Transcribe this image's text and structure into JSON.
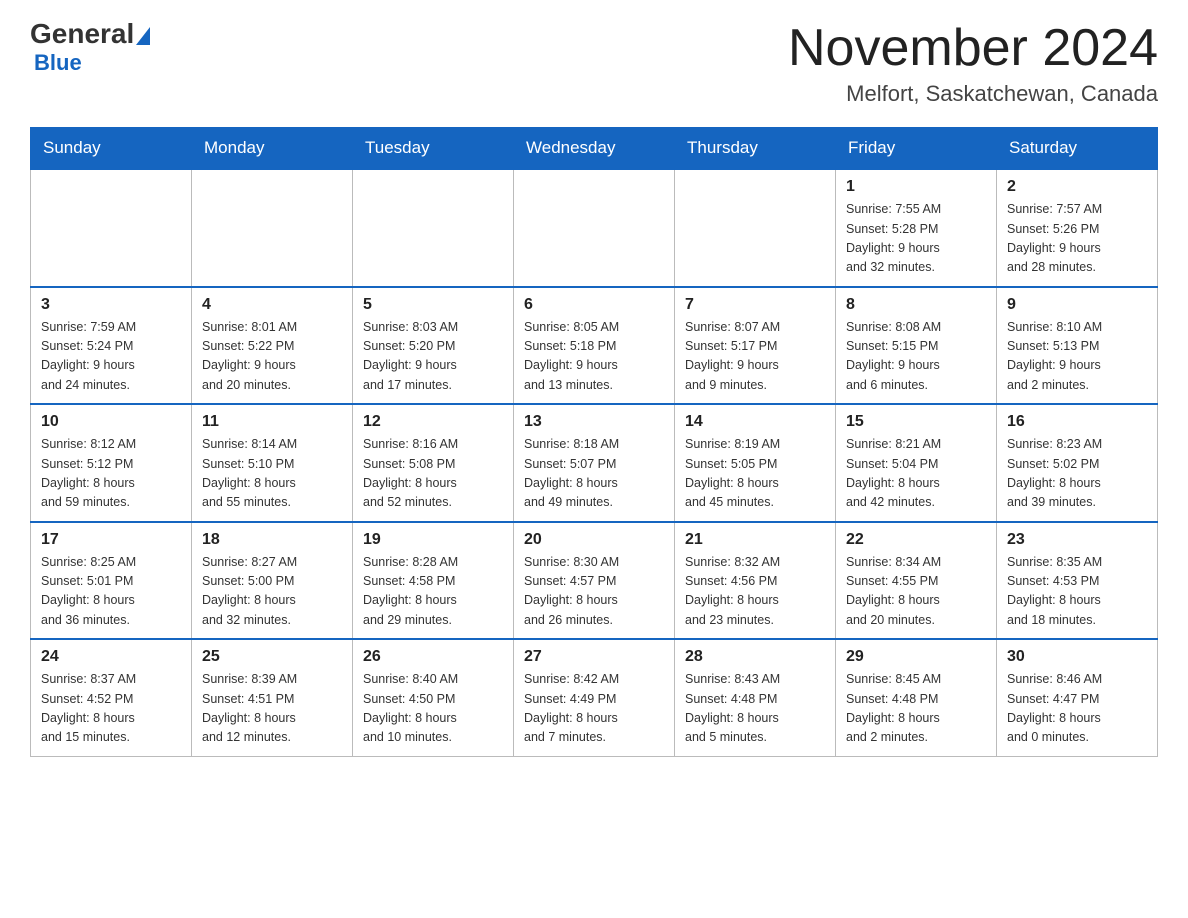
{
  "header": {
    "logo_general": "General",
    "logo_blue": "Blue",
    "month_title": "November 2024",
    "location": "Melfort, Saskatchewan, Canada"
  },
  "days_of_week": [
    "Sunday",
    "Monday",
    "Tuesday",
    "Wednesday",
    "Thursday",
    "Friday",
    "Saturday"
  ],
  "weeks": [
    [
      {
        "day": "",
        "info": ""
      },
      {
        "day": "",
        "info": ""
      },
      {
        "day": "",
        "info": ""
      },
      {
        "day": "",
        "info": ""
      },
      {
        "day": "",
        "info": ""
      },
      {
        "day": "1",
        "info": "Sunrise: 7:55 AM\nSunset: 5:28 PM\nDaylight: 9 hours\nand 32 minutes."
      },
      {
        "day": "2",
        "info": "Sunrise: 7:57 AM\nSunset: 5:26 PM\nDaylight: 9 hours\nand 28 minutes."
      }
    ],
    [
      {
        "day": "3",
        "info": "Sunrise: 7:59 AM\nSunset: 5:24 PM\nDaylight: 9 hours\nand 24 minutes."
      },
      {
        "day": "4",
        "info": "Sunrise: 8:01 AM\nSunset: 5:22 PM\nDaylight: 9 hours\nand 20 minutes."
      },
      {
        "day": "5",
        "info": "Sunrise: 8:03 AM\nSunset: 5:20 PM\nDaylight: 9 hours\nand 17 minutes."
      },
      {
        "day": "6",
        "info": "Sunrise: 8:05 AM\nSunset: 5:18 PM\nDaylight: 9 hours\nand 13 minutes."
      },
      {
        "day": "7",
        "info": "Sunrise: 8:07 AM\nSunset: 5:17 PM\nDaylight: 9 hours\nand 9 minutes."
      },
      {
        "day": "8",
        "info": "Sunrise: 8:08 AM\nSunset: 5:15 PM\nDaylight: 9 hours\nand 6 minutes."
      },
      {
        "day": "9",
        "info": "Sunrise: 8:10 AM\nSunset: 5:13 PM\nDaylight: 9 hours\nand 2 minutes."
      }
    ],
    [
      {
        "day": "10",
        "info": "Sunrise: 8:12 AM\nSunset: 5:12 PM\nDaylight: 8 hours\nand 59 minutes."
      },
      {
        "day": "11",
        "info": "Sunrise: 8:14 AM\nSunset: 5:10 PM\nDaylight: 8 hours\nand 55 minutes."
      },
      {
        "day": "12",
        "info": "Sunrise: 8:16 AM\nSunset: 5:08 PM\nDaylight: 8 hours\nand 52 minutes."
      },
      {
        "day": "13",
        "info": "Sunrise: 8:18 AM\nSunset: 5:07 PM\nDaylight: 8 hours\nand 49 minutes."
      },
      {
        "day": "14",
        "info": "Sunrise: 8:19 AM\nSunset: 5:05 PM\nDaylight: 8 hours\nand 45 minutes."
      },
      {
        "day": "15",
        "info": "Sunrise: 8:21 AM\nSunset: 5:04 PM\nDaylight: 8 hours\nand 42 minutes."
      },
      {
        "day": "16",
        "info": "Sunrise: 8:23 AM\nSunset: 5:02 PM\nDaylight: 8 hours\nand 39 minutes."
      }
    ],
    [
      {
        "day": "17",
        "info": "Sunrise: 8:25 AM\nSunset: 5:01 PM\nDaylight: 8 hours\nand 36 minutes."
      },
      {
        "day": "18",
        "info": "Sunrise: 8:27 AM\nSunset: 5:00 PM\nDaylight: 8 hours\nand 32 minutes."
      },
      {
        "day": "19",
        "info": "Sunrise: 8:28 AM\nSunset: 4:58 PM\nDaylight: 8 hours\nand 29 minutes."
      },
      {
        "day": "20",
        "info": "Sunrise: 8:30 AM\nSunset: 4:57 PM\nDaylight: 8 hours\nand 26 minutes."
      },
      {
        "day": "21",
        "info": "Sunrise: 8:32 AM\nSunset: 4:56 PM\nDaylight: 8 hours\nand 23 minutes."
      },
      {
        "day": "22",
        "info": "Sunrise: 8:34 AM\nSunset: 4:55 PM\nDaylight: 8 hours\nand 20 minutes."
      },
      {
        "day": "23",
        "info": "Sunrise: 8:35 AM\nSunset: 4:53 PM\nDaylight: 8 hours\nand 18 minutes."
      }
    ],
    [
      {
        "day": "24",
        "info": "Sunrise: 8:37 AM\nSunset: 4:52 PM\nDaylight: 8 hours\nand 15 minutes."
      },
      {
        "day": "25",
        "info": "Sunrise: 8:39 AM\nSunset: 4:51 PM\nDaylight: 8 hours\nand 12 minutes."
      },
      {
        "day": "26",
        "info": "Sunrise: 8:40 AM\nSunset: 4:50 PM\nDaylight: 8 hours\nand 10 minutes."
      },
      {
        "day": "27",
        "info": "Sunrise: 8:42 AM\nSunset: 4:49 PM\nDaylight: 8 hours\nand 7 minutes."
      },
      {
        "day": "28",
        "info": "Sunrise: 8:43 AM\nSunset: 4:48 PM\nDaylight: 8 hours\nand 5 minutes."
      },
      {
        "day": "29",
        "info": "Sunrise: 8:45 AM\nSunset: 4:48 PM\nDaylight: 8 hours\nand 2 minutes."
      },
      {
        "day": "30",
        "info": "Sunrise: 8:46 AM\nSunset: 4:47 PM\nDaylight: 8 hours\nand 0 minutes."
      }
    ]
  ]
}
